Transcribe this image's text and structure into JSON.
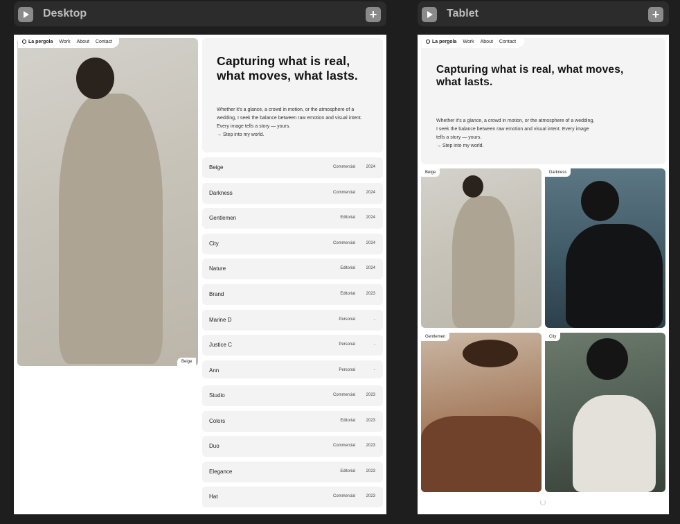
{
  "panels": {
    "desktop": {
      "title": "Desktop"
    },
    "tablet": {
      "title": "Tablet"
    }
  },
  "site": {
    "logo": "La pergola",
    "nav": [
      "Work",
      "About",
      "Contact"
    ],
    "hero_title": "Capturing what is real, what moves, what lasts.",
    "hero_desc": "Whether it's a glance, a crowd in motion, or the atmosphere of a wedding, I seek the balance between raw emotion and visual intent. Every image tells a story — yours.",
    "hero_cta": "→ Step into my world.",
    "featured_tag": "Beige"
  },
  "projects": [
    {
      "name": "Beige",
      "category": "Commercial",
      "year": "2024"
    },
    {
      "name": "Darkness",
      "category": "Commercial",
      "year": "2024"
    },
    {
      "name": "Gentlemen",
      "category": "Editorial",
      "year": "2024"
    },
    {
      "name": "City",
      "category": "Commercial",
      "year": "2024"
    },
    {
      "name": "Nature",
      "category": "Editorial",
      "year": "2024"
    },
    {
      "name": "Brand",
      "category": "Editorial",
      "year": "2023"
    },
    {
      "name": "Marine D",
      "category": "Personal",
      "year": "-"
    },
    {
      "name": "Justice C",
      "category": "Personal",
      "year": "-"
    },
    {
      "name": "Ann",
      "category": "Personal",
      "year": "-"
    },
    {
      "name": "Studio",
      "category": "Commercial",
      "year": "2023"
    },
    {
      "name": "Colors",
      "category": "Editorial",
      "year": "2023"
    },
    {
      "name": "Duo",
      "category": "Commercial",
      "year": "2023"
    },
    {
      "name": "Elegance",
      "category": "Editorial",
      "year": "2023"
    },
    {
      "name": "Hat",
      "category": "Commercial",
      "year": "2023"
    }
  ],
  "tablet_grid": [
    "Beige",
    "Darkness",
    "Gentlemen",
    "City"
  ],
  "icons": {
    "play": "play-icon",
    "add": "plus-icon",
    "loading": "spinner-icon"
  }
}
